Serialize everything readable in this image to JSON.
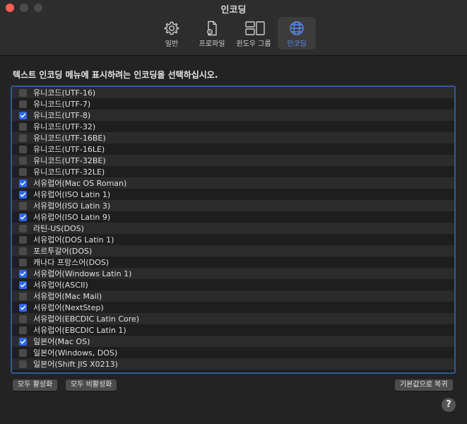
{
  "window": {
    "title": "인코딩"
  },
  "toolbar": {
    "tabs": [
      {
        "label": "일반",
        "icon": "gear-icon"
      },
      {
        "label": "프로파일",
        "icon": "document-gear-icon"
      },
      {
        "label": "윈도우 그룹",
        "icon": "window-group-icon"
      },
      {
        "label": "인코딩",
        "icon": "globe-icon",
        "selected": true
      }
    ]
  },
  "instruction": "텍스트 인코딩 메뉴에 표시하려는 인코딩을 선택하십시오.",
  "encodings": [
    {
      "label": "유니코드(UTF-16)",
      "checked": false
    },
    {
      "label": "유니코드(UTF-7)",
      "checked": false
    },
    {
      "label": "유니코드(UTF-8)",
      "checked": true
    },
    {
      "label": "유니코드(UTF-32)",
      "checked": false
    },
    {
      "label": "유니코드(UTF-16BE)",
      "checked": false
    },
    {
      "label": "유니코드(UTF-16LE)",
      "checked": false
    },
    {
      "label": "유니코드(UTF-32BE)",
      "checked": false
    },
    {
      "label": "유니코드(UTF-32LE)",
      "checked": false
    },
    {
      "label": "서유럽어(Mac OS Roman)",
      "checked": true
    },
    {
      "label": "서유럽어(ISO Latin 1)",
      "checked": true
    },
    {
      "label": "서유럽어(ISO Latin 3)",
      "checked": false
    },
    {
      "label": "서유럽어(ISO Latin 9)",
      "checked": true
    },
    {
      "label": "라틴-US(DOS)",
      "checked": false
    },
    {
      "label": "서유럽어(DOS Latin 1)",
      "checked": false
    },
    {
      "label": "포르투갈어(DOS)",
      "checked": false
    },
    {
      "label": "캐나다 프랑스어(DOS)",
      "checked": false
    },
    {
      "label": "서유럽어(Windows Latin 1)",
      "checked": true
    },
    {
      "label": "서유럽어(ASCII)",
      "checked": true
    },
    {
      "label": "서유럽어(Mac Mail)",
      "checked": false
    },
    {
      "label": "서유럽어(NextStep)",
      "checked": true
    },
    {
      "label": "서유럽어(EBCDIC Latin Core)",
      "checked": false
    },
    {
      "label": "서유럽어(EBCDIC Latin 1)",
      "checked": false
    },
    {
      "label": "일본어(Mac OS)",
      "checked": true
    },
    {
      "label": "일본어(Windows, DOS)",
      "checked": false
    },
    {
      "label": "일본어(Shift JIS X0213)",
      "checked": false
    }
  ],
  "buttons": {
    "enable_all": "모두 활성화",
    "disable_all": "모두 비활성화",
    "restore_defaults": "기본값으로 복귀"
  },
  "help": "?",
  "colors": {
    "accent": "#2f66f6",
    "selected_tab": "#5a8cf0",
    "list_border": "#2f5b95"
  }
}
